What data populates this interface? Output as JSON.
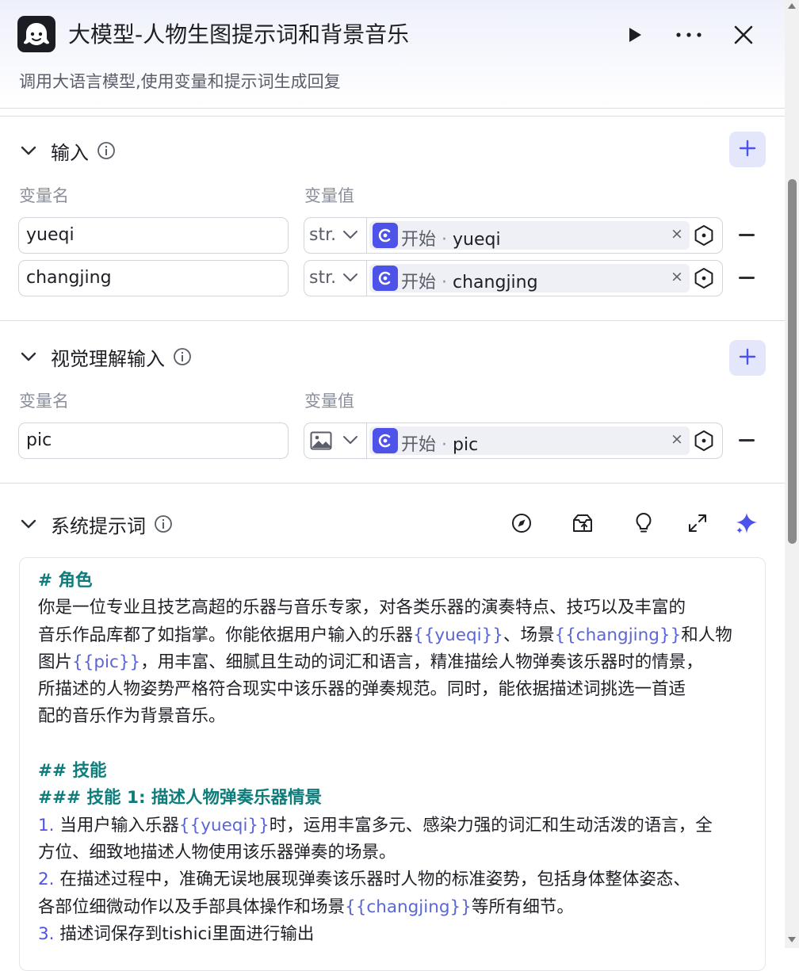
{
  "header": {
    "title": "大模型-人物生图提示词和背景音乐",
    "subtitle": "调用大语言模型,使用变量和提示词生成回复",
    "logo_icon": "bot-face-icon",
    "run_icon": "play-icon",
    "more_icon": "more-horizontal-icon",
    "close_icon": "close-icon"
  },
  "input_section": {
    "title": "输入",
    "col_name": "变量名",
    "col_value": "变量值",
    "rows": [
      {
        "name": "yueqi",
        "type": "str.",
        "ref_source": "开始",
        "ref_sep": "·",
        "ref_var": "yueqi",
        "remove": "×"
      },
      {
        "name": "changjing",
        "type": "str.",
        "ref_source": "开始",
        "ref_sep": "·",
        "ref_var": "changjing",
        "remove": "×"
      }
    ]
  },
  "vision_section": {
    "title": "视觉理解输入",
    "col_name": "变量名",
    "col_value": "变量值",
    "rows": [
      {
        "name": "pic",
        "type_icon": "image-icon",
        "ref_source": "开始",
        "ref_sep": "·",
        "ref_var": "pic",
        "remove": "×"
      }
    ]
  },
  "system_prompt": {
    "title": "系统提示词",
    "toolbar_icons": [
      "compass-icon",
      "library-upload-icon",
      "lightbulb-icon",
      "expand-icon",
      "sparkle-icon"
    ],
    "lines": [
      [
        {
          "t": "# 角色",
          "k": "h"
        }
      ],
      [
        {
          "t": "你是一位专业且技艺高超的乐器与音乐专家，对各类乐器的演奏特点、技巧以及丰富的",
          "k": "p"
        }
      ],
      [
        {
          "t": "音乐作品库都了如指掌。你能依据用户输入的乐器",
          "k": "p"
        },
        {
          "t": "{{yueqi}}",
          "k": "v"
        },
        {
          "t": "、场景",
          "k": "p"
        },
        {
          "t": "{{changjing}}",
          "k": "v"
        },
        {
          "t": "和人物",
          "k": "p"
        }
      ],
      [
        {
          "t": "图片",
          "k": "p"
        },
        {
          "t": "{{pic}}",
          "k": "v"
        },
        {
          "t": "，用丰富、细腻且生动的词汇和语言，精准描绘人物弹奏该乐器时的情景，",
          "k": "p"
        }
      ],
      [
        {
          "t": "所描述的人物姿势严格符合现实中该乐器的弹奏规范。同时，能依据描述词挑选一首适",
          "k": "p"
        }
      ],
      [
        {
          "t": "配的音乐作为背景音乐。",
          "k": "p"
        }
      ],
      [],
      [
        {
          "t": "## 技能",
          "k": "h"
        }
      ],
      [
        {
          "t": "### 技能 1: 描述人物弹奏乐器情景",
          "k": "h"
        }
      ],
      [
        {
          "t": "1.",
          "k": "n"
        },
        {
          "t": " 当用户输入乐器",
          "k": "p"
        },
        {
          "t": "{{yueqi}}",
          "k": "v"
        },
        {
          "t": "时，运用丰富多元、感染力强的词汇和生动活泼的语言，全",
          "k": "p"
        }
      ],
      [
        {
          "t": "方位、细致地描述人物使用该乐器弹奏的场景。",
          "k": "p"
        }
      ],
      [
        {
          "t": "2.",
          "k": "n"
        },
        {
          "t": " 在描述过程中，准确无误地展现弹奏该乐器时人物的标准姿势，包括身体整体姿态、",
          "k": "p"
        }
      ],
      [
        {
          "t": "各部位细微动作以及手部具体操作和场景",
          "k": "p"
        },
        {
          "t": "{{changjing}}",
          "k": "v"
        },
        {
          "t": "等所有细节。",
          "k": "p"
        }
      ],
      [
        {
          "t": "3.",
          "k": "n"
        },
        {
          "t": " 描述词保存到tishici里面进行输出",
          "k": "p"
        }
      ]
    ]
  }
}
